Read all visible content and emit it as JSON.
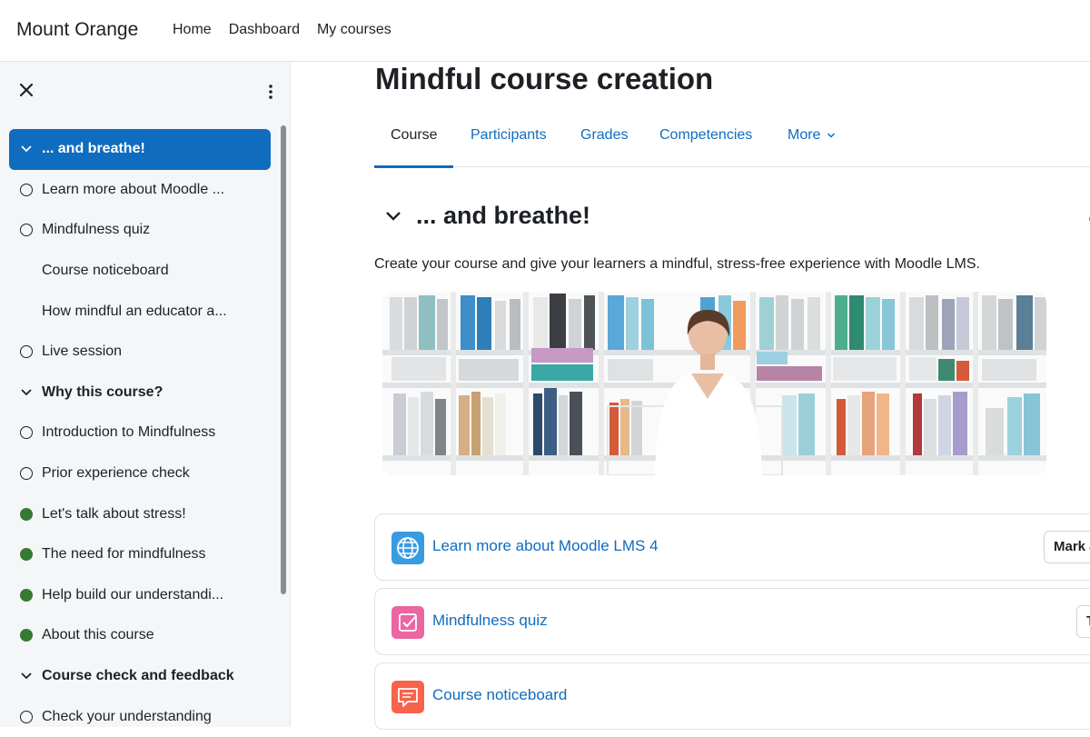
{
  "navbar": {
    "brand": "Mount Orange",
    "links": [
      "Home",
      "Dashboard",
      "My courses"
    ]
  },
  "drawer": {
    "close_icon": "close-icon",
    "menu_icon": "kebab-menu-icon",
    "items": [
      {
        "label": "... and breathe!",
        "kind": "section",
        "marker": "chevron-down",
        "active": true
      },
      {
        "label": "Learn more about Moodle ...",
        "kind": "activity",
        "marker": "circle-empty"
      },
      {
        "label": "Mindfulness quiz",
        "kind": "activity",
        "marker": "circle-empty"
      },
      {
        "label": "Course noticeboard",
        "kind": "activity",
        "marker": "none"
      },
      {
        "label": "How mindful an educator a...",
        "kind": "activity",
        "marker": "none"
      },
      {
        "label": "Live session",
        "kind": "activity",
        "marker": "circle-empty"
      },
      {
        "label": "Why this course?",
        "kind": "section",
        "marker": "chevron-down"
      },
      {
        "label": "Introduction to Mindfulness",
        "kind": "activity",
        "marker": "circle-empty"
      },
      {
        "label": "Prior experience check",
        "kind": "activity",
        "marker": "circle-empty"
      },
      {
        "label": "Let's talk about stress!",
        "kind": "activity",
        "marker": "circle-complete"
      },
      {
        "label": "The need for mindfulness",
        "kind": "activity",
        "marker": "circle-complete"
      },
      {
        "label": "Help build our understandi...",
        "kind": "activity",
        "marker": "circle-complete"
      },
      {
        "label": "About this course",
        "kind": "activity",
        "marker": "circle-complete"
      },
      {
        "label": "Course check and feedback",
        "kind": "section",
        "marker": "chevron-down"
      },
      {
        "label": "Check your understanding",
        "kind": "activity",
        "marker": "circle-empty"
      }
    ]
  },
  "main": {
    "title": "Mindful course creation",
    "tabs": [
      {
        "label": "Course",
        "active": true
      },
      {
        "label": "Participants"
      },
      {
        "label": "Grades"
      },
      {
        "label": "Competencies"
      },
      {
        "label": "More"
      }
    ],
    "section": {
      "title": "... and breathe!",
      "summary": "Create your course and give your learners a mindful, stress-free experience with Moodle LMS.",
      "banner": "Photo of a woman meditating in front of bookshelves"
    },
    "activities": [
      {
        "name": "Learn more about Moodle LMS 4",
        "icon": "globe-icon",
        "button": "Mark as done"
      },
      {
        "name": "Mindfulness quiz",
        "icon": "quiz-icon",
        "button": "To do"
      },
      {
        "name": "Course noticeboard",
        "icon": "forum-icon",
        "button": ""
      }
    ]
  },
  "colors": {
    "brand_blue": "#0f6cbf",
    "complete_green": "#357a32",
    "drawer_bg": "#f5f6f8",
    "url_icon_bg": "#399be2",
    "quiz_icon_bg": "#eb66a2",
    "forum_icon_bg": "#f7634d"
  }
}
